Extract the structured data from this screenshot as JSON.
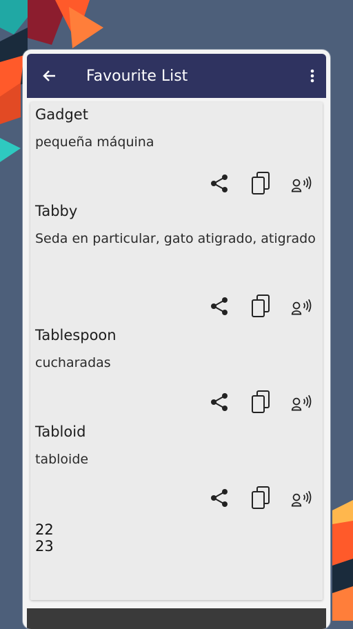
{
  "appbar": {
    "title": "Favourite List"
  },
  "entries": [
    {
      "word": "Gadget",
      "meaning": "pequeña máquina"
    },
    {
      "word": "Tabby",
      "meaning": "Seda en particular, gato atigrado, atigrado"
    },
    {
      "word": "Tablespoon",
      "meaning": "cucharadas"
    },
    {
      "word": "Tabloid",
      "meaning": "tabloide"
    }
  ],
  "footer": {
    "line1": "22",
    "line2": "23"
  },
  "icons": {
    "back": "back-arrow-icon",
    "menu": "more-vert-icon",
    "share": "share-icon",
    "copy": "copy-icon",
    "speak": "speak-icon"
  },
  "colors": {
    "appbar": "#2f3360",
    "background": "#4d5f7a",
    "accent_orange": "#ff5a2a",
    "accent_teal": "#1fb5ac"
  }
}
